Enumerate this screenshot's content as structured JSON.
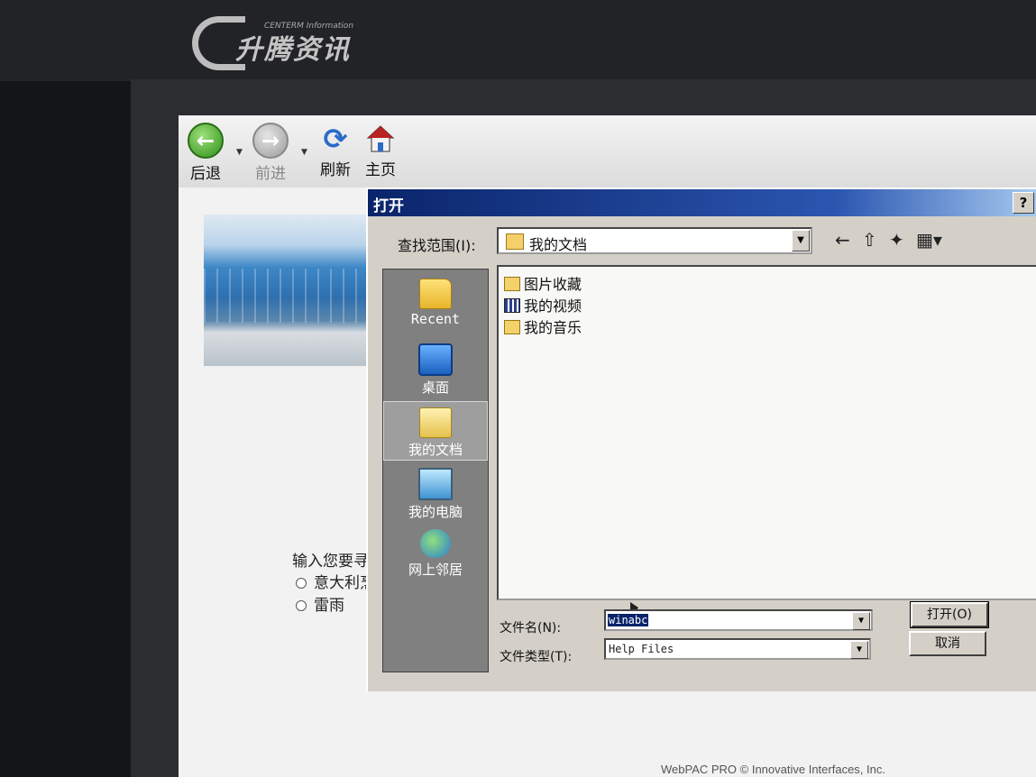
{
  "monitor": {
    "brand_cn": "升腾资讯",
    "brand_en": "CENTERM Information"
  },
  "toolbar": {
    "back": "后退",
    "forward": "前进",
    "refresh": "刷新",
    "home": "主页"
  },
  "page": {
    "prompt": "输入您要寻",
    "radio1": "意大利烹",
    "radio2": "雷雨",
    "footer": "WebPAC PRO © Innovative Interfaces, Inc."
  },
  "dialog": {
    "title": "打开",
    "help": "?",
    "look_in_label": "查找范围(I):",
    "look_in_value": "我的文档",
    "places": [
      "Recent",
      "桌面",
      "我的文档",
      "我的电脑",
      "网上邻居"
    ],
    "files": [
      "图片收藏",
      "我的视频",
      "我的音乐"
    ],
    "filename_label": "文件名(N):",
    "filename_value": "winabc",
    "filetype_label": "文件类型(T):",
    "filetype_value": "Help Files",
    "open_button": "打开(O)",
    "cancel_button": "取消"
  }
}
